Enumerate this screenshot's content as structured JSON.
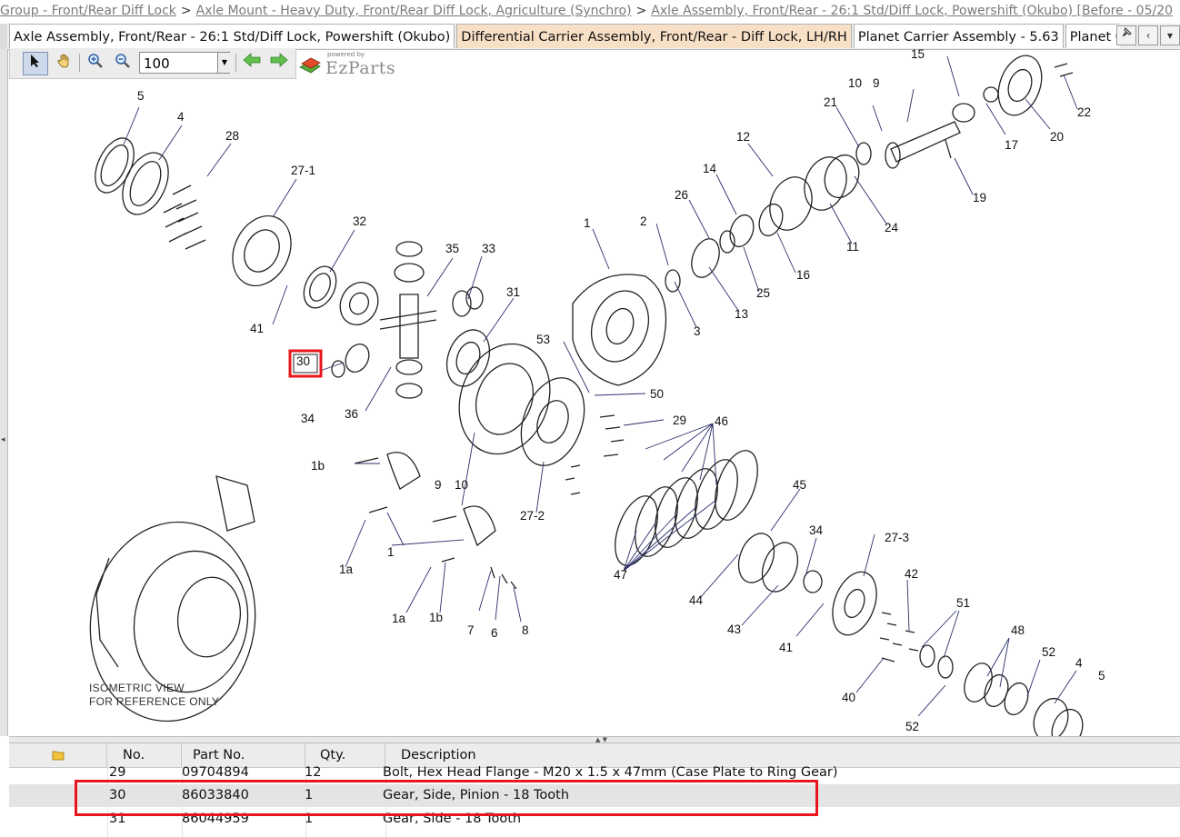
{
  "breadcrumb": {
    "items": [
      "Group - Front/Rear Diff Lock",
      "Axle Mount - Heavy Duty, Front/Rear Diff Lock, Agriculture (Synchro)",
      "Axle Assembly, Front/Rear - 26:1 Std/Diff Lock, Powershift (Okubo) [Before - 05/20"
    ],
    "separator": ">"
  },
  "tabs": [
    {
      "label": "Axle Assembly, Front/Rear - 26:1 Std/Diff Lock, Powershift (Okubo)",
      "active": false
    },
    {
      "label": "Differential Carrier Assembly, Front/Rear - Diff Lock, LH/RH",
      "active": true
    },
    {
      "label": "Planet Carrier Assembly - 5.63",
      "active": false
    },
    {
      "label": "Planet Carrier",
      "active": false
    }
  ],
  "toolbar": {
    "zoom_value": "100",
    "icons": [
      "pointer-icon",
      "pan-hand-icon",
      "zoom-in-icon",
      "zoom-out-icon",
      "back-arrow-icon",
      "forward-arrow-icon"
    ]
  },
  "logo": {
    "powered": "powered by",
    "name": "EzParts"
  },
  "diagram": {
    "iso_note_line1": "ISOMETRIC VIEW",
    "iso_note_line2": "FOR REFERENCE ONLY",
    "callouts": [
      "5",
      "4",
      "28",
      "27-1",
      "32",
      "35",
      "33",
      "31",
      "41",
      "30",
      "34",
      "36",
      "1",
      "2",
      "3",
      "13",
      "26",
      "14",
      "25",
      "16",
      "12",
      "11",
      "24",
      "21",
      "10",
      "9",
      "15",
      "17",
      "20",
      "22",
      "19",
      "53",
      "50",
      "29",
      "46",
      "1b",
      "9",
      "10",
      "27-2",
      "45",
      "34",
      "27-3",
      "1a",
      "1",
      "47",
      "44",
      "43",
      "41",
      "42",
      "51",
      "48",
      "52",
      "4",
      "5",
      "40",
      "52",
      "1a",
      "1b",
      "7",
      "6",
      "8"
    ],
    "selected_callout": "30"
  },
  "grid": {
    "headers": {
      "icon": "folder-icon",
      "no": "No.",
      "part_no": "Part No.",
      "qty": "Qty.",
      "description": "Description"
    },
    "rows": [
      {
        "no": "29",
        "part_no": "09704894",
        "qty": "12",
        "description": "Bolt, Hex Head Flange - M20 x 1.5 x 47mm (Case Plate to Ring Gear)"
      },
      {
        "no": "30",
        "part_no": "86033840",
        "qty": "1",
        "description": "Gear, Side, Pinion - 18 Tooth"
      },
      {
        "no": "31",
        "part_no": "86044959",
        "qty": "1",
        "description": "Gear, Side - 18 Tooth"
      }
    ]
  },
  "colors": {
    "highlight": "#e8161c",
    "active_tab": "#f8e0c6",
    "selected_row": "#e4e4e4"
  }
}
